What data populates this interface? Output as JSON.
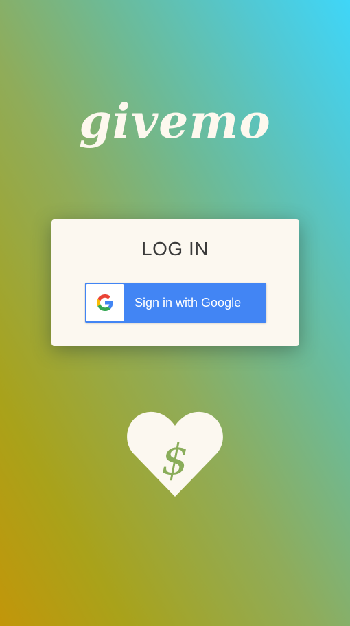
{
  "app": {
    "logo_text": "givemo"
  },
  "login_card": {
    "title": "LOG IN",
    "google_button": {
      "label": "Sign in with Google",
      "icon": "google-g-icon"
    }
  },
  "footer": {
    "emblem_icon": "heart-dollar-icon"
  },
  "colors": {
    "card_background": "#fcf8f0",
    "google_blue": "#4285f4",
    "emblem_dollar": "#8aad5a",
    "logo_text": "#fdf8ee"
  }
}
